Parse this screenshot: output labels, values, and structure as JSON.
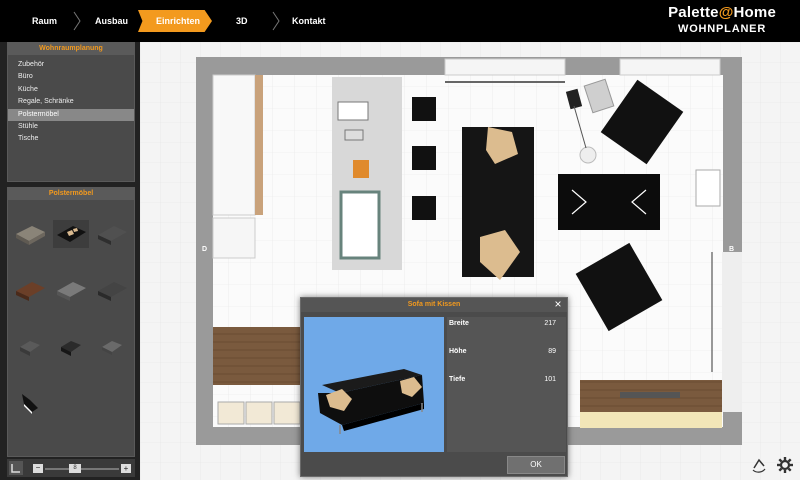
{
  "nav": {
    "steps": [
      "Raum",
      "Ausbau",
      "Einrichten",
      "3D",
      "Kontakt"
    ],
    "active": "Einrichten"
  },
  "brand": {
    "name_left": "Palette",
    "name_at": "@",
    "name_right": "Home",
    "product": "WOHNPLANER"
  },
  "room_panel": {
    "title": "Wohnraumplanung",
    "items": [
      "Zubehör",
      "Büro",
      "Küche",
      "Regale, Schränke",
      "Polstermöbel",
      "Stühle",
      "Tische"
    ],
    "selected": "Polstermöbel"
  },
  "catalog_panel": {
    "title": "Polstermöbel"
  },
  "zoom": {
    "minus": "−",
    "plus": "+",
    "value": "8"
  },
  "floorplan": {
    "wall_label_left": "D",
    "wall_label_right": "B"
  },
  "dialog": {
    "title": "Sofa mit Kissen",
    "props": [
      {
        "label": "Breite",
        "value": "217"
      },
      {
        "label": "Höhe",
        "value": "89"
      },
      {
        "label": "Tiefe",
        "value": "101"
      }
    ],
    "ok_label": "OK"
  },
  "colors": {
    "accent": "#f39a1e",
    "preview_bg": "#6fa9e8"
  }
}
